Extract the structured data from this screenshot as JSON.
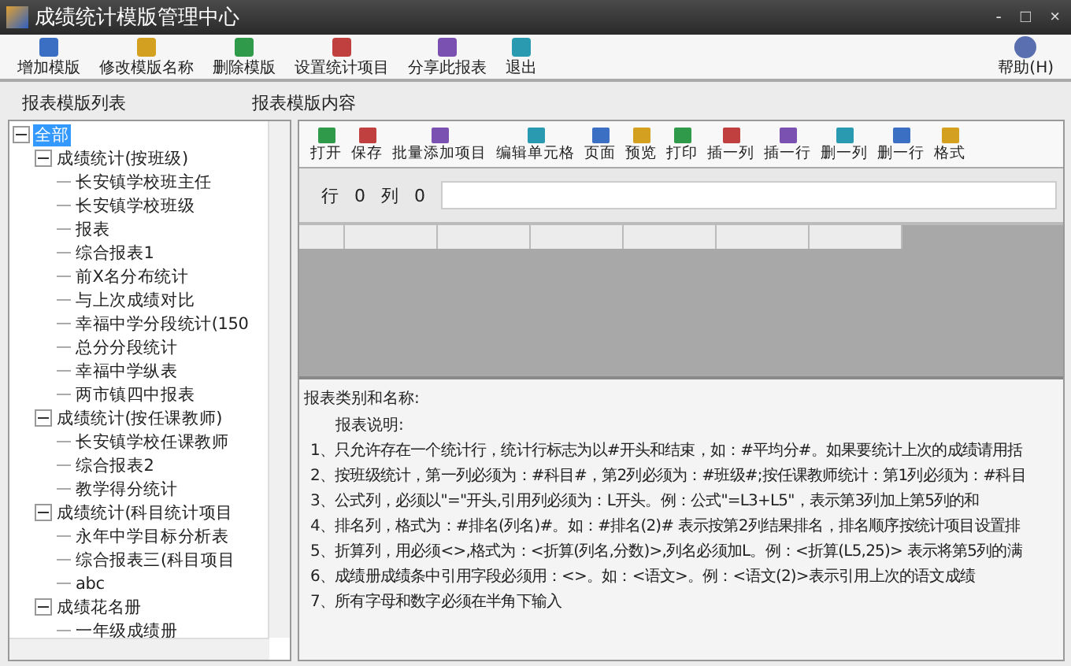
{
  "window": {
    "title": "成绩统计模版管理中心",
    "controls": [
      "-",
      "□",
      "×"
    ]
  },
  "main_toolbar": {
    "buttons": [
      "增加模版",
      "修改模版名称",
      "删除模版",
      "设置统计项目",
      "分享此报表",
      "退出"
    ],
    "help": "帮助(H)"
  },
  "left_panel": {
    "title": "报表模版列表",
    "tree": [
      {
        "label": "全部",
        "selected": true,
        "expanded": true,
        "children": [
          {
            "label": "成绩统计(按班级)",
            "selected": false,
            "expanded": true,
            "children": [
              {
                "label": "长安镇学校班主任",
                "selected": false
              },
              {
                "label": "长安镇学校班级",
                "selected": false
              },
              {
                "label": "报表",
                "selected": false
              },
              {
                "label": "综合报表1",
                "selected": false
              },
              {
                "label": "前X名分布统计",
                "selected": false
              },
              {
                "label": "与上次成绩对比",
                "selected": false
              },
              {
                "label": "幸福中学分段统计(150",
                "selected": false
              },
              {
                "label": "总分分段统计",
                "selected": false
              },
              {
                "label": "幸福中学纵表",
                "selected": false
              },
              {
                "label": "两市镇四中报表",
                "selected": false
              }
            ]
          },
          {
            "label": "成绩统计(按任课教师)",
            "selected": false,
            "expanded": true,
            "children": [
              {
                "label": "长安镇学校任课教师",
                "selected": false
              },
              {
                "label": "综合报表2",
                "selected": false
              },
              {
                "label": "教学得分统计",
                "selected": false
              }
            ]
          },
          {
            "label": "成绩统计(科目统计项目",
            "selected": false,
            "expanded": true,
            "children": [
              {
                "label": "永年中学目标分析表",
                "selected": false
              },
              {
                "label": "综合报表三(科目项目",
                "selected": false
              },
              {
                "label": "abc",
                "selected": false
              }
            ]
          },
          {
            "label": "成绩花名册",
            "selected": false,
            "expanded": true,
            "children": [
              {
                "label": "一年级成绩册",
                "selected": false
              }
            ]
          }
        ]
      }
    ]
  },
  "right_panel": {
    "title": "报表模版内容",
    "toolbar": [
      "打开",
      "保存",
      "批量添加项目",
      "编辑单元格",
      "页面",
      "预览",
      "打印",
      "插一列",
      "插一行",
      "删一列",
      "删一行",
      "格式"
    ],
    "row_label": "行",
    "row_value": "0",
    "col_label": "列",
    "col_value": "0",
    "category_label": "报表类别和名称:",
    "notes_label": "报表说明:",
    "notes": [
      "1、只允许存在一个统计行，统计行标志为以#开头和结束，如：#平均分#。如果要统计上次的成绩请用括",
      "2、按班级统计，第一列必须为：#科目#，第2列必须为：#班级#;按任课教师统计：第1列必须为：#科目",
      "3、公式列，必须以\"=\"开头,引用列必须为：L开头。例：公式\"=L3+L5\"，表示第3列加上第5列的和",
      "4、排名列，格式为：#排名(列名)#。如：#排名(2)# 表示按第2列结果排名，排名顺序按统计项目设置排",
      "5、折算列，用必须<>,格式为：<折算(列名,分数)>,列名必须加L。例：<折算(L5,25)> 表示将第5列的满",
      "6、成绩册成绩条中引用字段必须用：<>。如：<语文>。例：<语文(2)>表示引用上次的语文成绩",
      "7、所有字母和数字必须在半角下输入"
    ]
  }
}
